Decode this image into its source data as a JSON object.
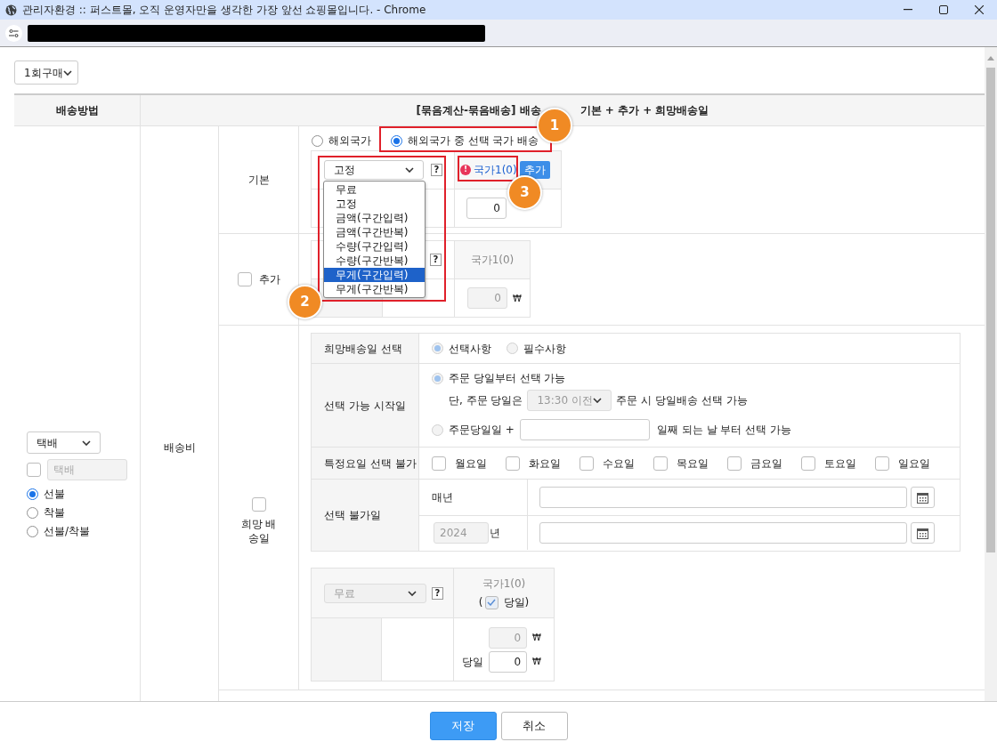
{
  "window": {
    "title": "관리자환경 :: 퍼스트몰, 오직 운영자만을 생각한 가장 앞선 쇼핑몰입니다. - Chrome"
  },
  "purchase_select": {
    "value": "1회구매"
  },
  "header": {
    "method": "배송방법",
    "formula_before": "[묶음계산-묶음배송] 배송",
    "formula_after": "기본 + 추가 + 희망배송일"
  },
  "method": {
    "select": "택배",
    "custom": {
      "checked": false,
      "placeholder": "택배",
      "disabled": true
    },
    "payment": [
      {
        "label": "선불",
        "selected": true
      },
      {
        "label": "착불",
        "selected": false
      },
      {
        "label": "선불/착불",
        "selected": false
      }
    ]
  },
  "fee_label": "배송비",
  "basic": {
    "label": "기본",
    "scope": [
      {
        "label": "해외국가",
        "selected": false
      },
      {
        "label": "해외국가 중 선택 국가 배송",
        "selected": true
      }
    ],
    "fee_type": "고정",
    "help": "?",
    "warning": "!",
    "country": "국가1(0)",
    "add_button": "추가",
    "amount": {
      "value": "0",
      "disabled": false
    },
    "dropdown": [
      {
        "label": "무료",
        "selected": false
      },
      {
        "label": "고정",
        "selected": false
      },
      {
        "label": "금액(구간입력)",
        "selected": false
      },
      {
        "label": "금액(구간반복)",
        "selected": false
      },
      {
        "label": "수량(구간입력)",
        "selected": false
      },
      {
        "label": "수량(구간반복)",
        "selected": false
      },
      {
        "label": "무게(구간입력)",
        "selected": true
      },
      {
        "label": "무게(구간반복)",
        "selected": false
      }
    ]
  },
  "extra": {
    "label": "추가",
    "checked": false,
    "help": "?",
    "country": "국가1(0)",
    "amount": {
      "value": "0",
      "disabled": true
    },
    "currency": "₩"
  },
  "hope": {
    "label": "희망 배송일",
    "checked": false,
    "select_row": {
      "label": "희망배송일 선택",
      "options": [
        {
          "label": "선택사항",
          "selected": true
        },
        {
          "label": "필수사항",
          "selected": false
        }
      ]
    },
    "start_row": {
      "label": "선택 가능 시작일",
      "options": [
        {
          "label": "주문 당일부터 선택 가능",
          "selected": true
        },
        {
          "label": "주문당일일 +",
          "selected": false
        }
      ],
      "note_before": "단, 주문 당일은",
      "cutoff": {
        "value": "13:30 이전",
        "disabled": true
      },
      "note_after": "주문 시 당일배송 선택 가능",
      "days_after": "일째 되는 날 부터 선택 가능"
    },
    "weekday_row": {
      "label": "특정요일 선택 불가",
      "days": [
        {
          "label": "월요일",
          "checked": false
        },
        {
          "label": "화요일",
          "checked": false
        },
        {
          "label": "수요일",
          "checked": false
        },
        {
          "label": "목요일",
          "checked": false
        },
        {
          "label": "금요일",
          "checked": false
        },
        {
          "label": "토요일",
          "checked": false
        },
        {
          "label": "일요일",
          "checked": false
        }
      ]
    },
    "blocked_row": {
      "label": "선택 불가일",
      "yearly": "매년",
      "year": {
        "value": "2024",
        "disabled": true
      },
      "year_unit": "년"
    },
    "fee_table": {
      "fee_type": {
        "value": "무료",
        "disabled": true
      },
      "help": "?",
      "country": "국가1(0)",
      "same_day": {
        "open": "(",
        "label": "당일)",
        "checked": true
      },
      "amount": {
        "value": "0",
        "disabled": true
      },
      "currency": "₩",
      "same_day_label": "당일",
      "same_day_amount": {
        "value": "0",
        "disabled": false
      },
      "same_day_currency": "₩"
    }
  },
  "footer": {
    "buttons": [
      {
        "label": "저장",
        "kind": "primary"
      },
      {
        "label": "취소",
        "kind": "secondary"
      }
    ]
  },
  "annotations": [
    {
      "number": "1"
    },
    {
      "number": "2"
    },
    {
      "number": "3"
    }
  ]
}
